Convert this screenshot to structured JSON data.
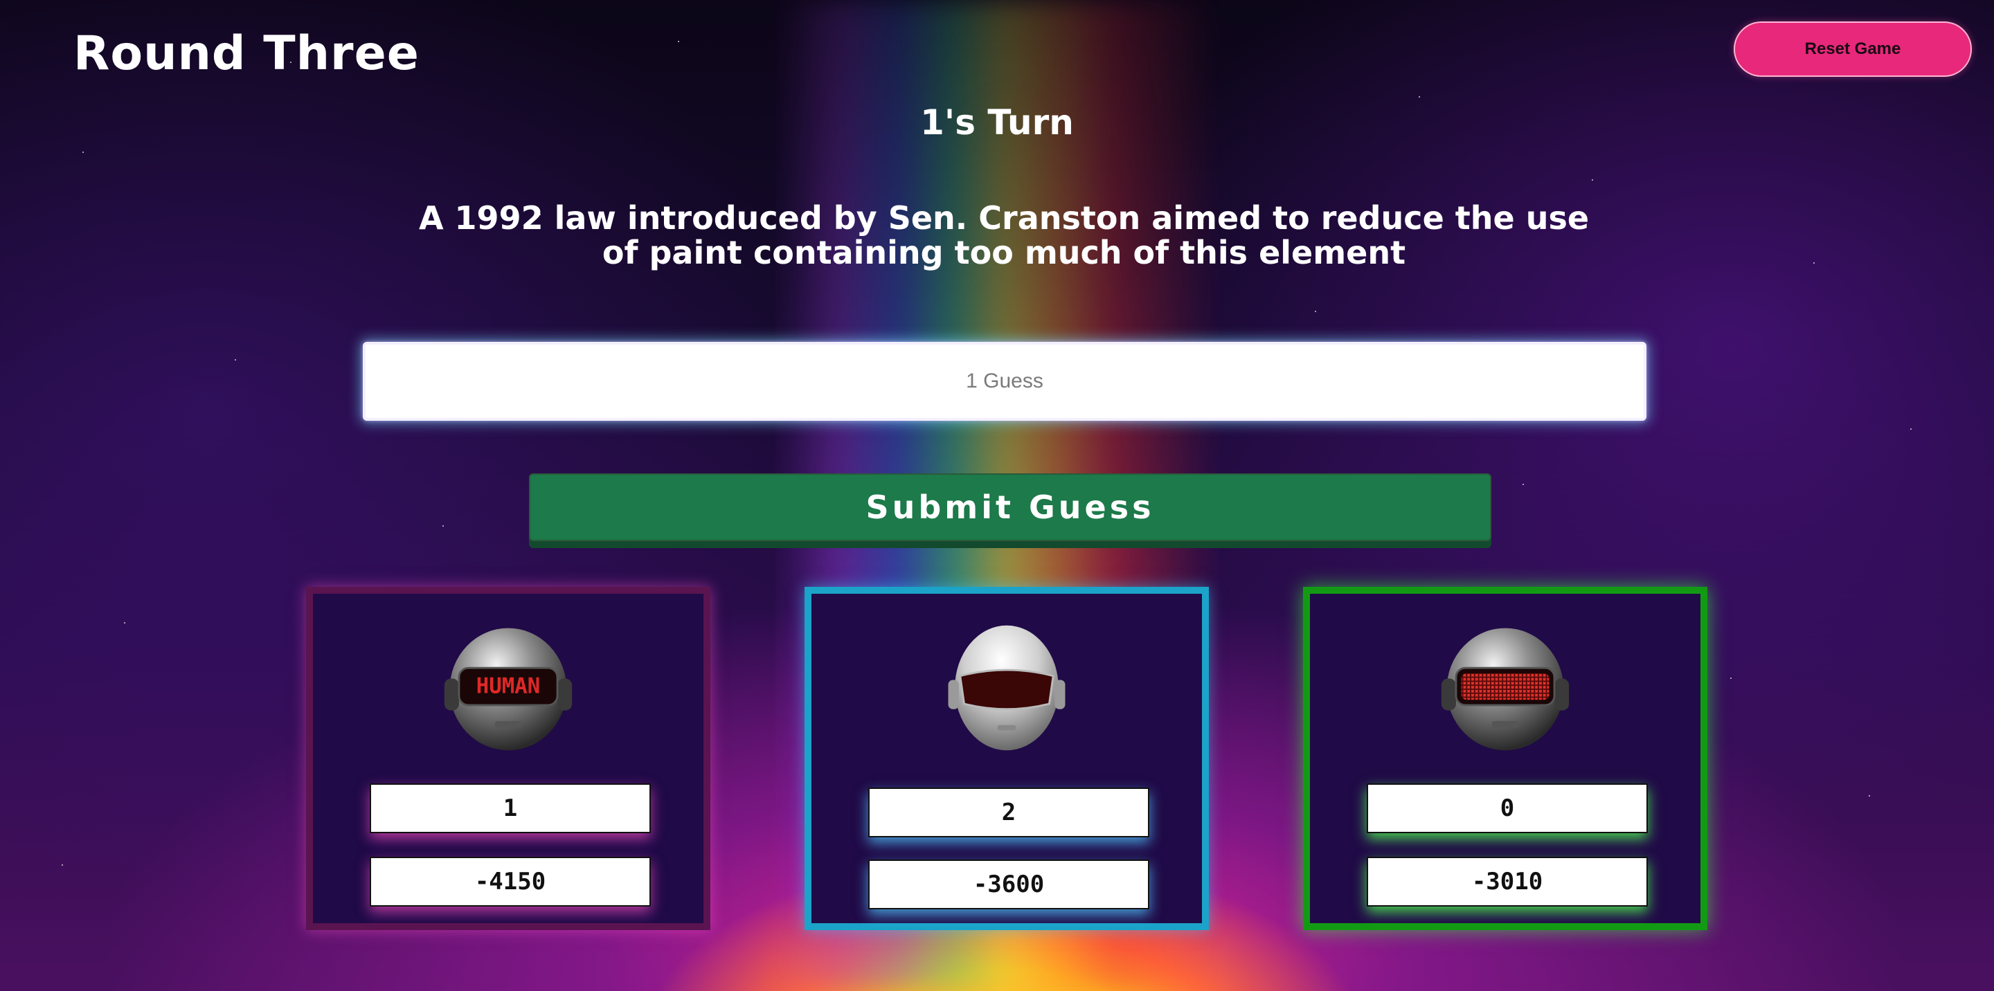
{
  "header": {
    "round_title": "Round Three",
    "reset_label": "Reset Game"
  },
  "turn_label": "1's Turn",
  "clue": "A 1992 law introduced by Sen. Cranston aimed to reduce the use of paint containing too much of this element",
  "guess": {
    "value": "",
    "placeholder": "1 Guess"
  },
  "submit_label": "Submit Guess",
  "players": [
    {
      "name": "1",
      "score": "-4150",
      "helmet_text": "HUMAN",
      "accent": "#5a1450",
      "active": false
    },
    {
      "name": "2",
      "score": "-3600",
      "helmet_text": "",
      "accent": "#1ba3c9",
      "active": false
    },
    {
      "name": "0",
      "score": "-3010",
      "helmet_text": "",
      "accent": "#139a14",
      "active": true
    }
  ],
  "colors": {
    "reset_button": "#e8287a",
    "submit_button": "#1d7a4a",
    "card_bg": "#200a47"
  }
}
